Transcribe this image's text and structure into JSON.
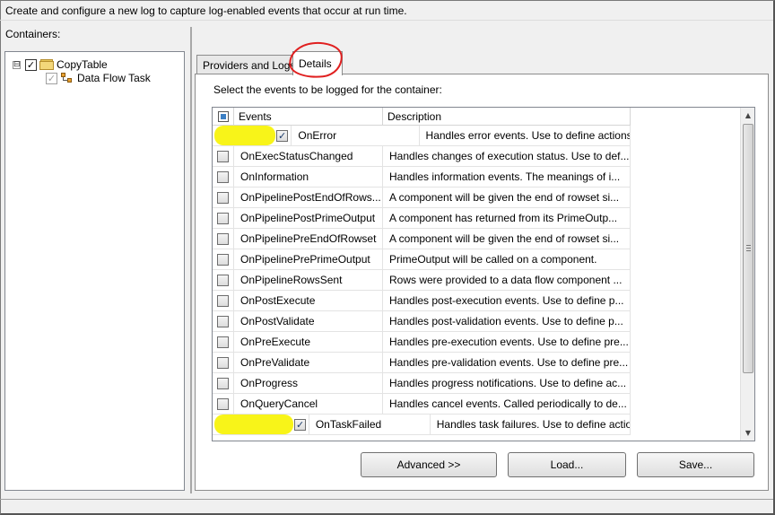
{
  "description": "Create and configure a new log to capture log-enabled events that occur at run time.",
  "containers_label": "Containers:",
  "tree": {
    "root": {
      "label": "CopyTable",
      "expander": "⊟",
      "checked": true
    },
    "child": {
      "label": "Data Flow Task",
      "checked": true
    }
  },
  "tabs": [
    {
      "label": "Providers and Logs",
      "active": false
    },
    {
      "label": "Details",
      "active": true
    }
  ],
  "prompt": "Select the events to be logged for the container:",
  "columns": {
    "events": "Events",
    "description": "Description"
  },
  "events": [
    {
      "name": "OnError",
      "description": "Handles error events. Use to define actions to p...",
      "checked": true,
      "highlighted": true
    },
    {
      "name": "OnExecStatusChanged",
      "description": "Handles changes of execution status. Use to def...",
      "checked": false
    },
    {
      "name": "OnInformation",
      "description": "Handles information events. The meanings of i...",
      "checked": false
    },
    {
      "name": "OnPipelinePostEndOfRows...",
      "description": "A component will be given the end of rowset si...",
      "checked": false
    },
    {
      "name": "OnPipelinePostPrimeOutput",
      "description": "A component has returned from its PrimeOutp...",
      "checked": false
    },
    {
      "name": "OnPipelinePreEndOfRowset",
      "description": "A component will be given the end of rowset si...",
      "checked": false
    },
    {
      "name": "OnPipelinePrePrimeOutput",
      "description": "PrimeOutput will be called on a component.",
      "checked": false
    },
    {
      "name": "OnPipelineRowsSent",
      "description": "Rows were provided to a data flow component ...",
      "checked": false
    },
    {
      "name": "OnPostExecute",
      "description": "Handles post-execution events. Use to define p...",
      "checked": false
    },
    {
      "name": "OnPostValidate",
      "description": "Handles post-validation events. Use to define p...",
      "checked": false
    },
    {
      "name": "OnPreExecute",
      "description": "Handles pre-execution events. Use to define pre...",
      "checked": false
    },
    {
      "name": "OnPreValidate",
      "description": "Handles pre-validation events. Use to define pre...",
      "checked": false
    },
    {
      "name": "OnProgress",
      "description": "Handles progress notifications. Use to define ac...",
      "checked": false
    },
    {
      "name": "OnQueryCancel",
      "description": "Handles cancel events. Called periodically to de...",
      "checked": false
    },
    {
      "name": "OnTaskFailed",
      "description": "Handles task failures. Use to define actions to p...",
      "checked": true,
      "highlighted": true
    }
  ],
  "buttons": {
    "advanced": "Advanced >>",
    "load": "Load...",
    "save": "Save..."
  },
  "colors": {
    "highlight": "#f7f300",
    "annotation_circle": "#e02020"
  }
}
